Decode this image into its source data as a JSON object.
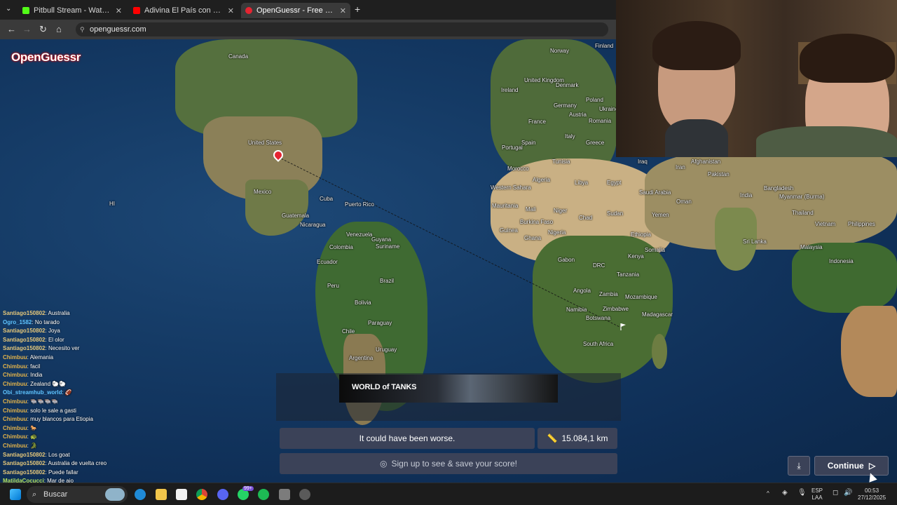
{
  "browser": {
    "tabs": [
      {
        "title": "Pitbull Stream - Watch Live",
        "active": false,
        "favicon_color": "#53fc18"
      },
      {
        "title": "Adivina El País con Gaspi - YouT",
        "active": false,
        "favicon_color": "#ff0000"
      },
      {
        "title": "OpenGuessr - Free GeoGuessr",
        "active": true,
        "favicon_color": "#e52431"
      }
    ],
    "new_tab": "+",
    "url": "openguessr.com"
  },
  "game": {
    "logo": "OpenGuessr",
    "result_text": "It could have been worse.",
    "distance": "15.084,1 km",
    "signup_text": "Sign up to see & save your score!",
    "continue_label": "Continue",
    "ad_brand": "WORLD of TANKS"
  },
  "map_labels": [
    {
      "text": "Canada"
    },
    {
      "text": "United States"
    },
    {
      "text": "Mexico"
    },
    {
      "text": "Cuba"
    },
    {
      "text": "Puerto Rico"
    },
    {
      "text": "Guatemala"
    },
    {
      "text": "Nicaragua"
    },
    {
      "text": "Venezuela"
    },
    {
      "text": "Colombia"
    },
    {
      "text": "Guyana"
    },
    {
      "text": "Suriname"
    },
    {
      "text": "Ecuador"
    },
    {
      "text": "Peru"
    },
    {
      "text": "Brazil"
    },
    {
      "text": "Bolivia"
    },
    {
      "text": "Paraguay"
    },
    {
      "text": "Chile"
    },
    {
      "text": "Uruguay"
    },
    {
      "text": "Argentina"
    },
    {
      "text": "Ireland"
    },
    {
      "text": "United Kingdom"
    },
    {
      "text": "Portugal"
    },
    {
      "text": "Morocco"
    },
    {
      "text": "Tunisia"
    },
    {
      "text": "Algeria"
    },
    {
      "text": "Libya"
    },
    {
      "text": "Egypt"
    },
    {
      "text": "Western Sahara"
    },
    {
      "text": "Mauritania"
    },
    {
      "text": "Mali"
    },
    {
      "text": "Niger"
    },
    {
      "text": "Chad"
    },
    {
      "text": "Sudan"
    },
    {
      "text": "Burkina Faso"
    },
    {
      "text": "Guinea"
    },
    {
      "text": "Ghana"
    },
    {
      "text": "Nigeria"
    },
    {
      "text": "Ethiopia"
    },
    {
      "text": "Somalia"
    },
    {
      "text": "Kenya"
    },
    {
      "text": "Gabon"
    },
    {
      "text": "DRC"
    },
    {
      "text": "Tanzania"
    },
    {
      "text": "Angola"
    },
    {
      "text": "Zambia"
    },
    {
      "text": "Mozambique"
    },
    {
      "text": "Namibia"
    },
    {
      "text": "Zimbabwe"
    },
    {
      "text": "Botswana"
    },
    {
      "text": "Madagascar"
    },
    {
      "text": "South Africa"
    },
    {
      "text": "Saudi Arabia"
    },
    {
      "text": "Yemen"
    },
    {
      "text": "Oman"
    },
    {
      "text": "Iraq"
    },
    {
      "text": "Iran"
    },
    {
      "text": "Afghanistan"
    },
    {
      "text": "Pakistan"
    },
    {
      "text": "India"
    },
    {
      "text": "Myanmar (Burma)"
    },
    {
      "text": "Thailand"
    },
    {
      "text": "Vietnam"
    },
    {
      "text": "Philippines"
    },
    {
      "text": "Malaysia"
    },
    {
      "text": "Indonesia"
    },
    {
      "text": "Norway"
    },
    {
      "text": "Finland"
    },
    {
      "text": "Denmark"
    },
    {
      "text": "Poland"
    },
    {
      "text": "Germany"
    },
    {
      "text": "Ukraine"
    },
    {
      "text": "France"
    },
    {
      "text": "Romania"
    },
    {
      "text": "Spain"
    },
    {
      "text": "Italy"
    },
    {
      "text": "Greece"
    },
    {
      "text": "Austria"
    },
    {
      "text": "Sri Lanka"
    },
    {
      "text": "Bangladesh"
    },
    {
      "text": "HI"
    }
  ],
  "chat": [
    {
      "user": "Santiago150802",
      "color": "#e6c87a",
      "msg": "Australia"
    },
    {
      "user": "Ogro_1582",
      "color": "#5fc4ff",
      "msg": "No tarado"
    },
    {
      "user": "Santiago150802",
      "color": "#e6c87a",
      "msg": "Joya"
    },
    {
      "user": "Santiago150802",
      "color": "#e6c87a",
      "msg": "El olor"
    },
    {
      "user": "Santiago150802",
      "color": "#e6c87a",
      "msg": "Necesito ver"
    },
    {
      "user": "Chimbuu",
      "color": "#e3b34a",
      "msg": "Alemania"
    },
    {
      "user": "Chimbuu",
      "color": "#e3b34a",
      "msg": "facil"
    },
    {
      "user": "Chimbuu",
      "color": "#e3b34a",
      "msg": "India"
    },
    {
      "user": "Chimbuu",
      "color": "#e3b34a",
      "msg": "Zealand 🐑🐑"
    },
    {
      "user": "Obi_streamhub_world",
      "color": "#5fc4ff",
      "msg": "🏈"
    },
    {
      "user": "Chimbuu",
      "color": "#e3b34a",
      "msg": "🐃🐃🐃🐃"
    },
    {
      "user": "Chimbuu",
      "color": "#e3b34a",
      "msg": "solo le sale a gasti"
    },
    {
      "user": "Chimbuu",
      "color": "#e3b34a",
      "msg": "muy blancos para Etiopia"
    },
    {
      "user": "Chimbuu",
      "color": "#e3b34a",
      "msg": "🐎"
    },
    {
      "user": "Chimbuu",
      "color": "#e3b34a",
      "msg": "🐢"
    },
    {
      "user": "Chimbuu",
      "color": "#e3b34a",
      "msg": "🐊"
    },
    {
      "user": "Santiago150802",
      "color": "#e6c87a",
      "msg": "Los goat"
    },
    {
      "user": "Santiago150802",
      "color": "#e6c87a",
      "msg": "Australia de vuelta creo"
    },
    {
      "user": "Santiago150802",
      "color": "#e6c87a",
      "msg": "Puede fallar"
    },
    {
      "user": "MatildaCocucci",
      "color": "#b5e05c",
      "msg": "Mar de ajo"
    }
  ],
  "taskbar": {
    "search_placeholder": "Buscar",
    "lang_top": "ESP",
    "lang_bottom": "LAA",
    "time": "00:53",
    "date": "27/12/2025",
    "badge_count": "99+"
  },
  "colors": {
    "accent": "#e52431",
    "panel": "#3b4258",
    "taskbar": "#1c1c1c"
  }
}
